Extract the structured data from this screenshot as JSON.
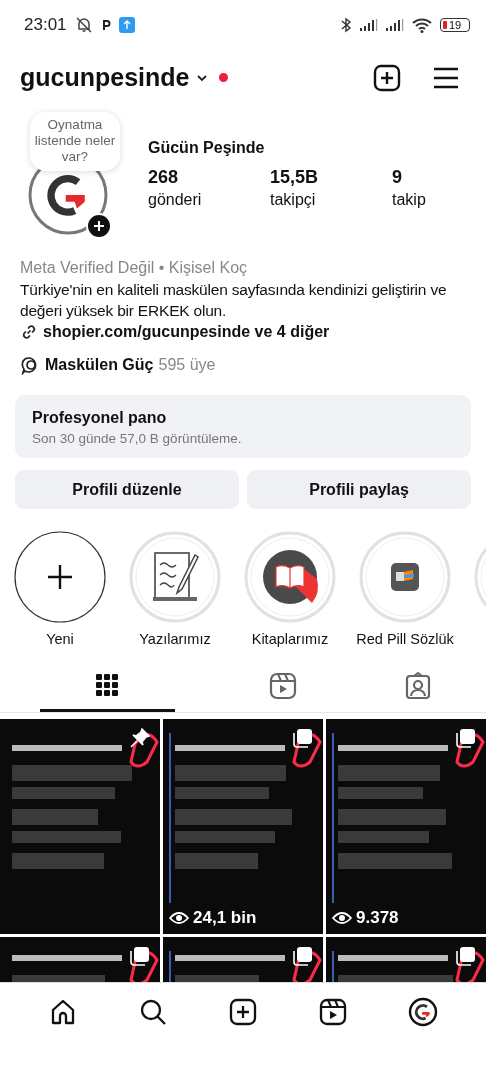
{
  "status_bar": {
    "time": "23:01",
    "battery": "19"
  },
  "header": {
    "username": "gucunpesinde",
    "unread_dot": true
  },
  "profile": {
    "tooltip": "Oynatma listende neler var?",
    "name": "Gücün Peşinde",
    "stats": [
      {
        "value": "268",
        "label": "gönderi"
      },
      {
        "value": "15,5B",
        "label": "takipçi"
      },
      {
        "value": "9",
        "label": "takip"
      }
    ],
    "category": "Meta Verified Değil • Kişisel Koç",
    "bio": "Türkiye'nin en kaliteli maskülen sayfasında kendinizi geliştirin ve değeri yüksek bir ERKEK olun.",
    "link": "shopier.com/gucunpesinde ve 4 diğer",
    "channel": {
      "name": "Maskülen Güç",
      "members": "595 üye"
    }
  },
  "dashboard": {
    "title": "Profesyonel pano",
    "subtitle": "Son 30 günde 57,0 B görüntüleme."
  },
  "buttons": [
    "Profili düzenle",
    "Profili paylaş"
  ],
  "highlights": [
    {
      "kind": "new",
      "title": "Yeni"
    },
    {
      "kind": "notes",
      "title": "Yazılarımız"
    },
    {
      "kind": "book",
      "title": "Kitaplarımız"
    },
    {
      "kind": "app",
      "title": "Red Pill Sözlük"
    },
    {
      "kind": "blank"
    }
  ],
  "tabs": [
    {
      "kind": "grid",
      "selected": true
    },
    {
      "kind": "reels",
      "selected": false
    },
    {
      "kind": "tagged",
      "selected": false
    }
  ],
  "posts": [
    {
      "kind": "picture",
      "pinned": true,
      "multiple": false
    },
    {
      "kind": "picture",
      "pinned": false,
      "multiple": true,
      "views": "24,1 bin"
    },
    {
      "kind": "picture",
      "pinned": false,
      "multiple": true,
      "views": "9.378"
    },
    {
      "kind": "picture",
      "pinned": false,
      "multiple": true
    },
    {
      "kind": "picture",
      "pinned": false,
      "multiple": true
    },
    {
      "kind": "picture",
      "pinned": false,
      "multiple": true
    }
  ],
  "nav": [
    {
      "kind": "home"
    },
    {
      "kind": "search"
    },
    {
      "kind": "create"
    },
    {
      "kind": "reels"
    },
    {
      "kind": "profile"
    }
  ]
}
